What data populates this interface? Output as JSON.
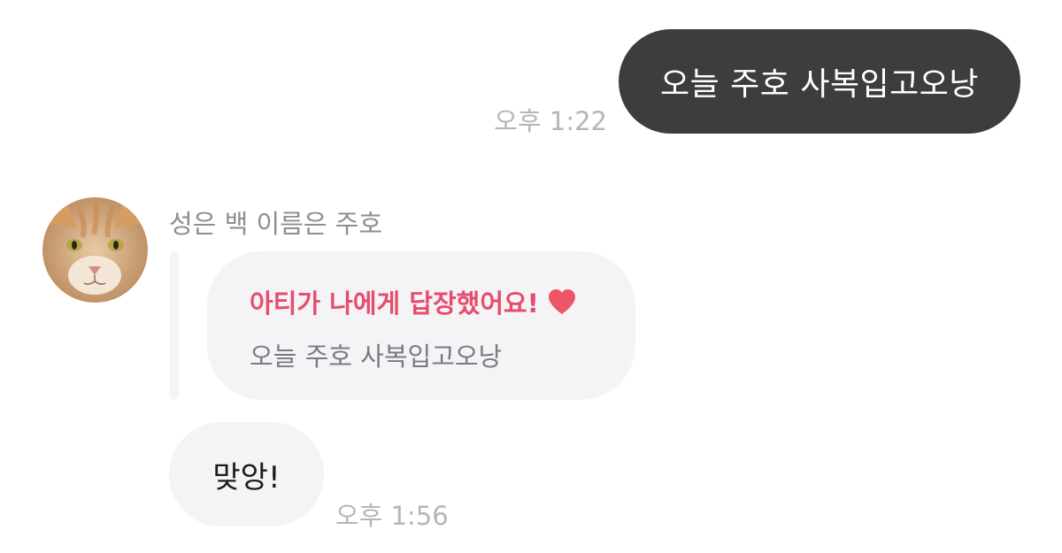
{
  "outgoing": {
    "text": "오늘 주호 사복입고오낭",
    "time": "오후 1:22"
  },
  "incoming": {
    "sender_name": "성은 백 이름은 주호",
    "reply": {
      "title": "아티가 나에게 답장했어요!",
      "quoted_text": "오늘 주호 사복입고오낭"
    },
    "message": {
      "text": "맞앙!",
      "time": "오후 1:56"
    }
  },
  "colors": {
    "outgoing_bubble": "#3d3d3d",
    "incoming_bubble": "#f4f4f7",
    "reply_title": "#e64d6d",
    "timestamp": "#b5b5bb"
  },
  "icons": {
    "reaction": "heart-icon",
    "avatar": "cat-avatar"
  }
}
